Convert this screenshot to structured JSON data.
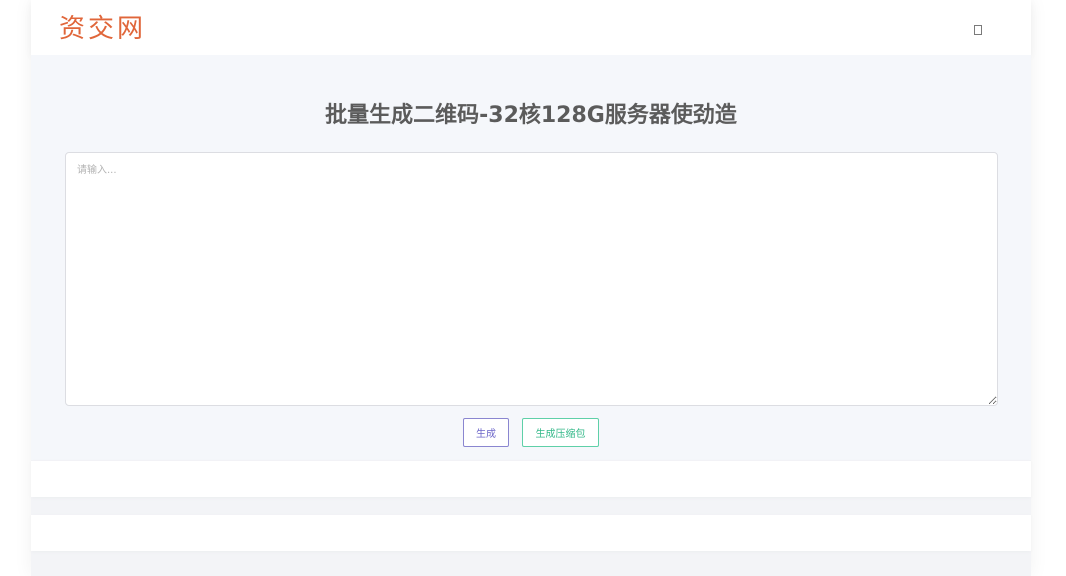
{
  "header": {
    "logo_text": "资交网",
    "menu_icon": "square-icon"
  },
  "main": {
    "title": "批量生成二维码-32核128G服务器使劲造",
    "input": {
      "placeholder": "请输入...",
      "value": ""
    },
    "buttons": {
      "generate_label": "生成",
      "zip_label": "生成压缩包"
    }
  },
  "colors": {
    "brand": "#e0663a",
    "generate_button": "#6c66c9",
    "zip_button": "#35b98a",
    "background": "#f5f7fb"
  }
}
